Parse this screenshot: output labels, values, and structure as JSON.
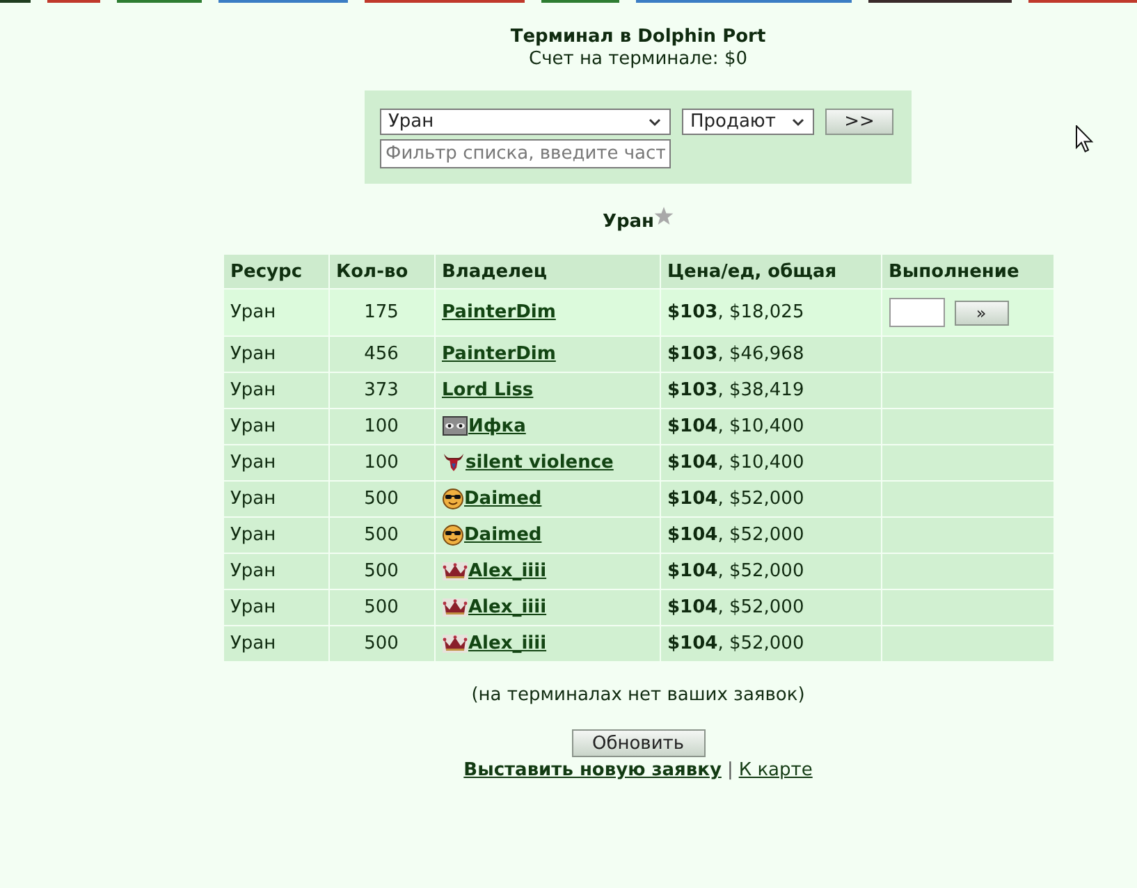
{
  "top_links": [
    {
      "color": "#1f3d1f"
    },
    {
      "color": "#c0392b"
    },
    {
      "color": "#2e7d32"
    },
    {
      "color": "#3b7dc4"
    },
    {
      "color": "#c0392b"
    },
    {
      "color": "#2e7d32"
    },
    {
      "color": "#3b7dc4"
    },
    {
      "color": "#3a2a2a"
    },
    {
      "color": "#c0392b"
    }
  ],
  "header": {
    "title": "Терминал в Dolphin Port",
    "account": "Счет на терминале: $0"
  },
  "filter": {
    "resource": "Уран",
    "mode": "Продают",
    "go_button": ">>",
    "search": {
      "placeholder": "Фильтр списка, введите част"
    }
  },
  "resource_heading": {
    "name": "Уран",
    "favorite": false
  },
  "table": {
    "columns": [
      "Ресурс",
      "Кол-во",
      "Владелец",
      "Цена/ед, общая",
      "Выполнение"
    ],
    "rows": [
      {
        "resource": "Уран",
        "quantity": "175",
        "owner": {
          "name": "PainterDim",
          "kind": "plain"
        },
        "price": "**$103**, $18,025",
        "highlighted": true,
        "execute": {
          "button": "»"
        }
      },
      {
        "resource": "Уран",
        "quantity": "456",
        "owner": {
          "name": "PainterDim",
          "kind": "plain"
        },
        "price": "**$103**, $46,968",
        "highlighted": false
      },
      {
        "resource": "Уран",
        "quantity": "373",
        "owner": {
          "name": "Lord Liss",
          "kind": "plain"
        },
        "price": "**$103**, $38,419",
        "highlighted": false
      },
      {
        "resource": "Уран",
        "quantity": "100",
        "owner": {
          "name": "Ифка",
          "kind": "eyes"
        },
        "price": "**$104**, $10,400",
        "highlighted": false
      },
      {
        "resource": "Уран",
        "quantity": "100",
        "owner": {
          "name": "silent violence",
          "kind": "horns"
        },
        "price": "**$104**, $10,400",
        "highlighted": false
      },
      {
        "resource": "Уран",
        "quantity": "500",
        "owner": {
          "name": "Daimed",
          "kind": "sunglasses"
        },
        "price": "**$104**, $52,000",
        "highlighted": false
      },
      {
        "resource": "Уран",
        "quantity": "500",
        "owner": {
          "name": "Daimed",
          "kind": "sunglasses"
        },
        "price": "**$104**, $52,000",
        "highlighted": false
      },
      {
        "resource": "Уран",
        "quantity": "500",
        "owner": {
          "name": "Alex_iiii",
          "kind": "crown"
        },
        "price": "**$104**, $52,000",
        "highlighted": false
      },
      {
        "resource": "Уран",
        "quantity": "500",
        "owner": {
          "name": "Alex_iiii",
          "kind": "crown"
        },
        "price": "**$104**, $52,000",
        "highlighted": false
      },
      {
        "resource": "Уран",
        "quantity": "500",
        "owner": {
          "name": "Alex_iiii",
          "kind": "crown"
        },
        "price": "**$104**, $52,000",
        "highlighted": false
      }
    ]
  },
  "note": "(на терминалах нет ваших заявок)",
  "refresh_button": "Обновить",
  "links": [
    {
      "label": "Выставить новую заявку",
      "kind": "primary"
    },
    {
      "label": "К карте",
      "kind": "plain"
    }
  ],
  "link_separator": "|"
}
